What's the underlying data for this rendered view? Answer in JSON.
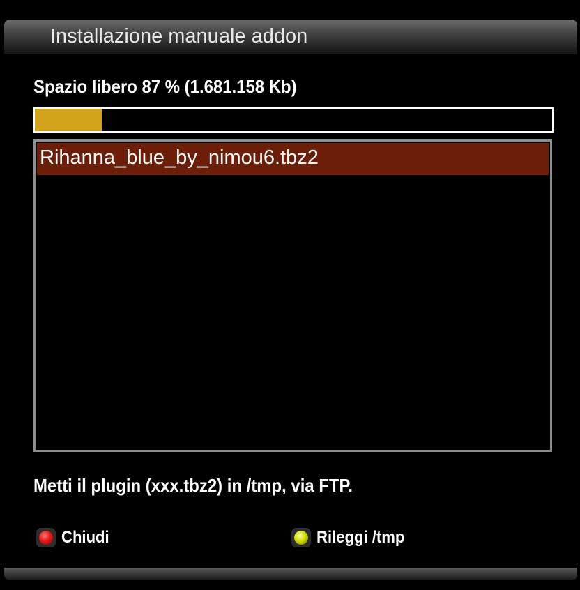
{
  "window": {
    "title": "Installazione manuale addon"
  },
  "storage": {
    "free_space_text": "Spazio libero 87 % (1.681.158 Kb)",
    "used_fraction": 0.13,
    "bar_fill_color": "#d3a31b"
  },
  "file_list": {
    "items": [
      {
        "label": "Rihanna_blue_by_nimou6.tbz2",
        "selected": true
      }
    ],
    "selected_color": "#6d1e08"
  },
  "hint": "Metti il plugin (xxx.tbz2) in /tmp, via FTP.",
  "keys": {
    "red": {
      "label": "Chiudi",
      "icon": "red-button-icon",
      "color": "#e81818"
    },
    "yellow": {
      "label": "Rileggi /tmp",
      "icon": "yellow-button-icon",
      "color": "#d2e000"
    }
  }
}
